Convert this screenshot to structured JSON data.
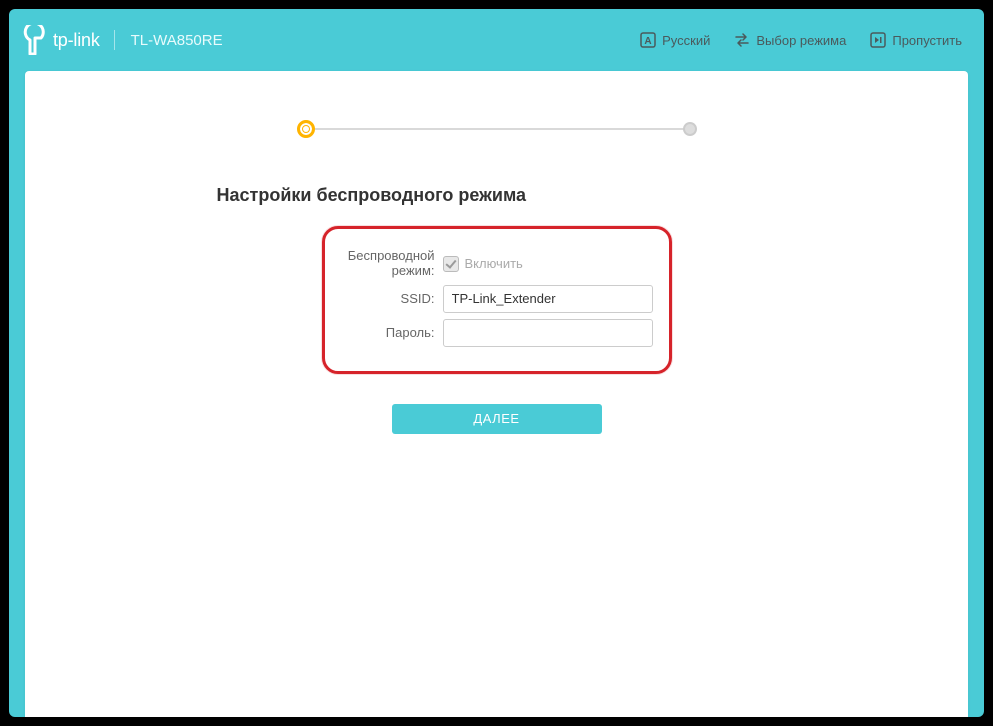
{
  "header": {
    "brand": "tp-link",
    "model": "TL-WA850RE",
    "language_action": "Русский",
    "mode_action": "Выбор режима",
    "skip_action": "Пропустить"
  },
  "page": {
    "title": "Настройки беспроводного режима"
  },
  "form": {
    "wireless_mode_label": "Беспроводной режим:",
    "enable_label": "Включить",
    "ssid_label": "SSID:",
    "ssid_value": "TP-Link_Extender",
    "password_label": "Пароль:",
    "password_value": ""
  },
  "buttons": {
    "next": "ДАЛЕЕ"
  }
}
